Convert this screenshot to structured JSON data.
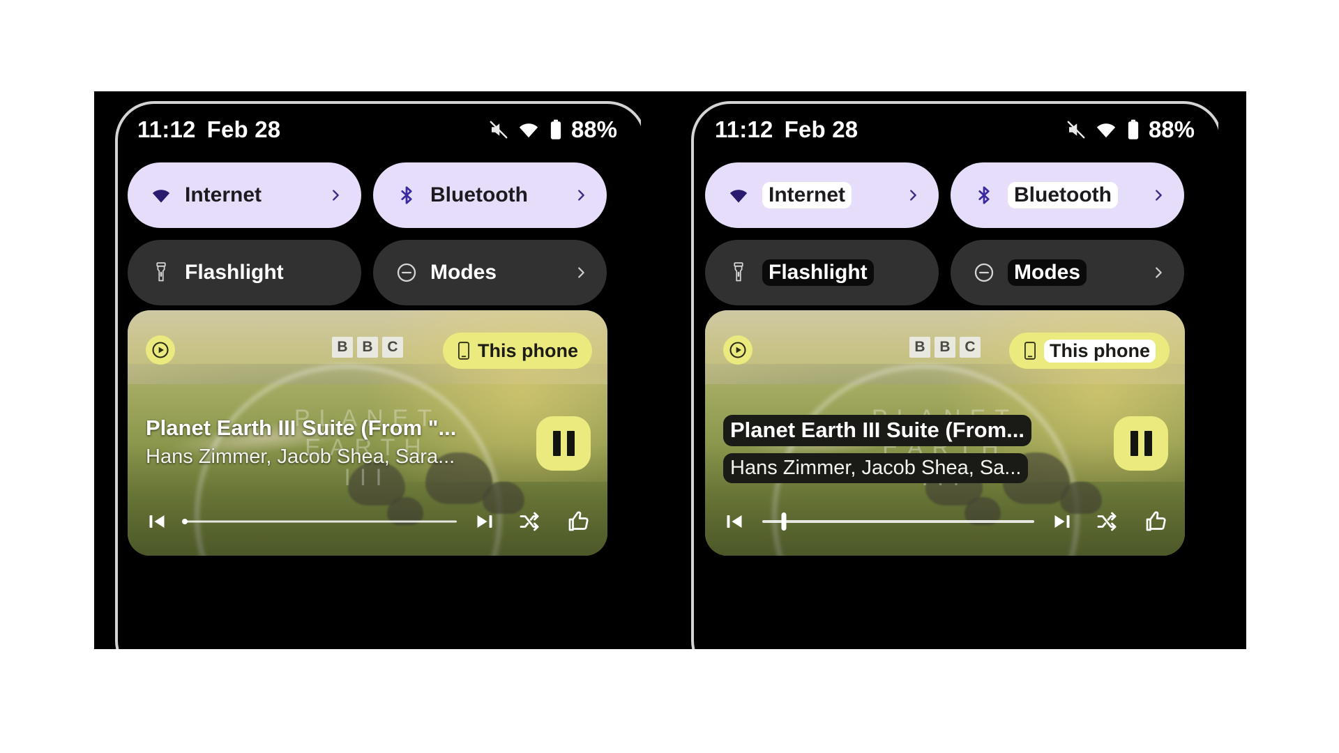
{
  "screen": {
    "background": "#ffffff",
    "panel_background": "#000000",
    "accent_on_tile": "#e6ddfb",
    "accent_off_tile": "#313131",
    "media_accent": "#eaea7e"
  },
  "panels": [
    {
      "id": "left",
      "variant": "normal",
      "statusbar": {
        "time": "11:12",
        "date": "Feb 28",
        "battery_percent": "88%",
        "icons": [
          "volume-mute-icon",
          "wifi-icon",
          "battery-icon"
        ]
      },
      "tiles": [
        {
          "label": "Internet",
          "icon": "wifi-icon",
          "state": "on",
          "chevron": true
        },
        {
          "label": "Bluetooth",
          "icon": "bluetooth-icon",
          "state": "on",
          "chevron": true
        },
        {
          "label": "Flashlight",
          "icon": "flashlight-icon",
          "state": "off",
          "chevron": false
        },
        {
          "label": "Modes",
          "icon": "minus-circle-icon",
          "state": "off",
          "chevron": true
        }
      ],
      "media": {
        "title": "Planet Earth III Suite (From \"...",
        "artist": "Hans Zimmer, Jacob Shea, Sara...",
        "output_device": "This phone",
        "output_icon": "phone-icon",
        "app_icon": "play-circle-icon",
        "artwork_watermark_line1": "PLANET",
        "artwork_watermark_line2": "EARTH",
        "artwork_watermark_line3": "III",
        "artwork_logo": [
          "B",
          "B",
          "C"
        ],
        "play_state": "playing",
        "play_pause_icon": "pause-icon",
        "progress_percent": 0,
        "controls": [
          "skip-previous-icon",
          "skip-next-icon",
          "shuffle-icon",
          "thumbs-up-icon"
        ]
      }
    },
    {
      "id": "right",
      "variant": "high-contrast-text",
      "statusbar": {
        "time": "11:12",
        "date": "Feb 28",
        "battery_percent": "88%",
        "icons": [
          "volume-mute-icon",
          "wifi-icon",
          "battery-icon"
        ]
      },
      "tiles": [
        {
          "label": "Internet",
          "icon": "wifi-icon",
          "state": "on",
          "chevron": true
        },
        {
          "label": "Bluetooth",
          "icon": "bluetooth-icon",
          "state": "on",
          "chevron": true
        },
        {
          "label": "Flashlight",
          "icon": "flashlight-icon",
          "state": "off",
          "chevron": false
        },
        {
          "label": "Modes",
          "icon": "minus-circle-icon",
          "state": "off",
          "chevron": true
        }
      ],
      "media": {
        "title": "Planet Earth III Suite (From...",
        "artist": "Hans Zimmer, Jacob Shea, Sa...",
        "output_device": "This phone",
        "output_icon": "phone-icon",
        "app_icon": "play-circle-icon",
        "artwork_watermark_line1": "PLANET",
        "artwork_watermark_line2": "EARTH",
        "artwork_watermark_line3": "III",
        "artwork_logo": [
          "B",
          "B",
          "C"
        ],
        "play_state": "playing",
        "play_pause_icon": "pause-icon",
        "progress_percent": 8,
        "controls": [
          "skip-previous-icon",
          "skip-next-icon",
          "shuffle-icon",
          "thumbs-up-icon"
        ]
      }
    }
  ]
}
